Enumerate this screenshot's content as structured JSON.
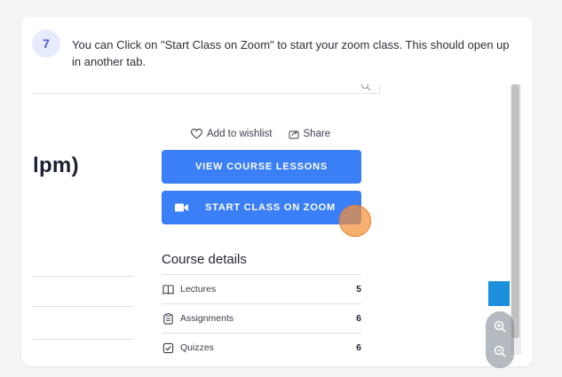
{
  "step": {
    "number": "7",
    "text": "You can Click on \"Start Class on Zoom\" to start your zoom class. This should open up in another tab."
  },
  "screenshot": {
    "course_title_fragment": "lpm)",
    "actions": {
      "wishlist_label": "Add to wishlist",
      "share_label": "Share"
    },
    "buttons": {
      "view_lessons": "VIEW COURSE LESSONS",
      "start_zoom": "START CLASS ON ZOOM"
    },
    "course_details": {
      "title": "Course details",
      "rows": [
        {
          "label": "Lectures",
          "count": "5",
          "icon": "book-icon"
        },
        {
          "label": "Assignments",
          "count": "6",
          "icon": "clipboard-icon"
        },
        {
          "label": "Quizzes",
          "count": "6",
          "icon": "checkbox-icon"
        }
      ]
    }
  },
  "colors": {
    "button_blue": "#3a7ff5",
    "cursor_highlight": "#f5923a",
    "step_badge_bg": "#e7ebfb",
    "step_badge_text": "#4a5bd4"
  }
}
